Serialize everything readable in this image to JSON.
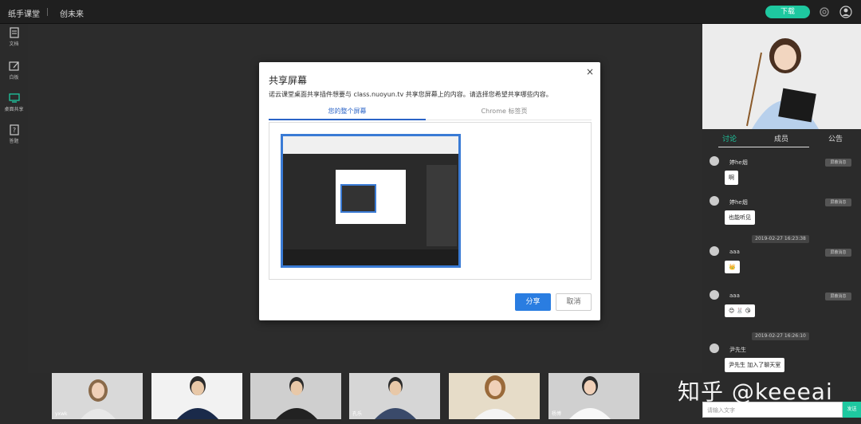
{
  "topbar": {
    "app_title": "纸手课堂",
    "room_name": "创未来",
    "download_label": "下载"
  },
  "left_toolbar": {
    "items": [
      {
        "label": "文档",
        "icon": "document-icon"
      },
      {
        "label": "白板",
        "icon": "whiteboard-icon"
      },
      {
        "label": "桌面共享",
        "icon": "monitor-icon"
      },
      {
        "label": "答题",
        "icon": "quiz-icon"
      }
    ]
  },
  "dialog": {
    "title": "共享屏幕",
    "close": "×",
    "description": "诺云课堂桌面共享插件想要与 class.nuoyun.tv 共享您屏幕上的内容。请选择您希望共享哪些内容。",
    "tabs": [
      "您的整个屏幕",
      "Chrome 标签页"
    ],
    "share_label": "分享",
    "cancel_label": "取消"
  },
  "videos": [
    {
      "name": "yxwk"
    },
    {
      "name": ""
    },
    {
      "name": ""
    },
    {
      "name": "孔乐"
    },
    {
      "name": ""
    },
    {
      "name": "杨博"
    }
  ],
  "right_panel": {
    "tabs": [
      "讨论",
      "成员",
      "公告"
    ],
    "messages": [
      {
        "name": "婷he烟",
        "badge": "屏蔽消息",
        "text": "啊"
      },
      {
        "name": "婷he烟",
        "badge": "屏蔽消息",
        "text": "也能听见"
      },
      {
        "timestamp": "2019-02-27 16:23:38"
      },
      {
        "name": "aaa",
        "badge": "屏蔽消息",
        "text": "👑"
      },
      {
        "name": "aaa",
        "badge": "屏蔽消息",
        "text": "😊 🐰 😘"
      },
      {
        "timestamp": "2019-02-27 16:26:10"
      },
      {
        "name": "尹先生",
        "text": "尹先生 加入了聊天室"
      }
    ],
    "input_placeholder": "请输入文字",
    "send_label": "发送"
  },
  "watermark": "知乎 @keeeai",
  "colors": {
    "accent": "#1ec8a0",
    "primary_blue": "#2a7de1"
  }
}
